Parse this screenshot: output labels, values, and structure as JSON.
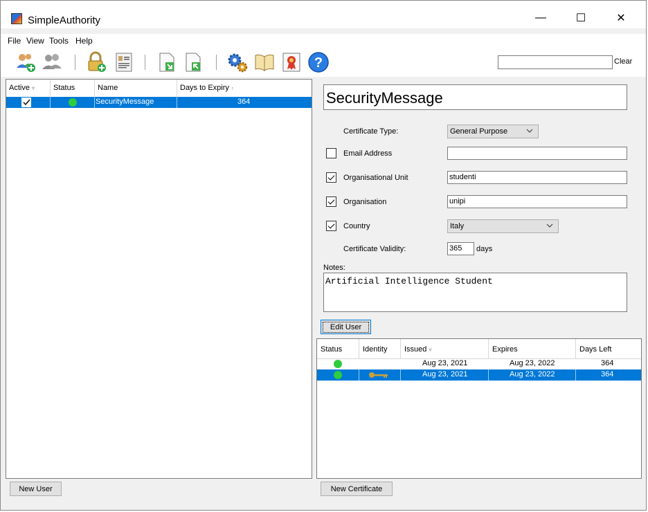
{
  "app": {
    "title": "SimpleAuthority"
  },
  "window_controls": {
    "minimize": "—",
    "maximize": "☐",
    "close": "✕"
  },
  "menu": [
    "File",
    "View",
    "Tools",
    "Help"
  ],
  "toolbar": {
    "search": {
      "value": "",
      "placeholder": ""
    },
    "clear_label": "Clear"
  },
  "users_table": {
    "columns": [
      "Active",
      "Status",
      "Name",
      "Days to Expiry"
    ],
    "rows": [
      {
        "active": true,
        "status": "green",
        "name": "SecurityMessage",
        "days": "364"
      }
    ]
  },
  "user_detail": {
    "name": "SecurityMessage",
    "cert_type_label": "Certificate Type:",
    "cert_type_value": "General Purpose",
    "email_label": "Email Address",
    "email_value": "",
    "ou_label": "Organisational Unit",
    "ou_value": "studenti",
    "org_label": "Organisation",
    "org_value": "unipi",
    "country_label": "Country",
    "country_value": "Italy",
    "validity_label": "Certificate Validity:",
    "validity_value": "365",
    "validity_unit": "days",
    "notes_label": "Notes:",
    "notes_value": "Artificial Intelligence Student",
    "edit_button": "Edit User"
  },
  "cert_table": {
    "columns": [
      "Status",
      "Identity",
      "Issued",
      "Expires",
      "Days Left"
    ],
    "rows": [
      {
        "status": "green",
        "identity": "",
        "issued": "Aug 23, 2021",
        "expires": "Aug 23, 2022",
        "days_left": "364"
      },
      {
        "status": "green",
        "identity": "key",
        "issued": "Aug 23, 2021",
        "expires": "Aug 23, 2022",
        "days_left": "364"
      }
    ]
  },
  "buttons": {
    "new_user": "New User",
    "new_certificate": "New Certificate"
  },
  "colors": {
    "selection": "#0078d7",
    "status_ok": "#2ecc40"
  }
}
